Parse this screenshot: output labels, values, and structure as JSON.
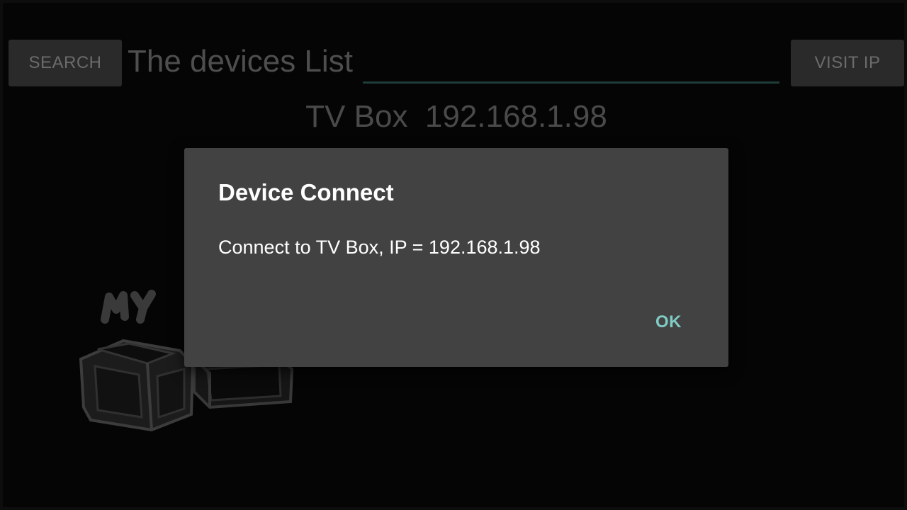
{
  "header": {
    "search_label": "SEARCH",
    "title": "The devices List",
    "ip_input_value": "",
    "visit_ip_label": "VISIT IP"
  },
  "devices": [
    {
      "label": "TV Box  192.168.1.98"
    }
  ],
  "background_logo": {
    "text": "MY TV",
    "icon": "tv-box-cubes-logo"
  },
  "dialog": {
    "title": "Device Connect",
    "message": "Connect to TV Box, IP = 192.168.1.98",
    "ok_label": "OK"
  },
  "colors": {
    "background": "#050505",
    "dialog_background": "#424242",
    "accent": "#80cbc4",
    "dim_text": "#4e4e4e"
  }
}
